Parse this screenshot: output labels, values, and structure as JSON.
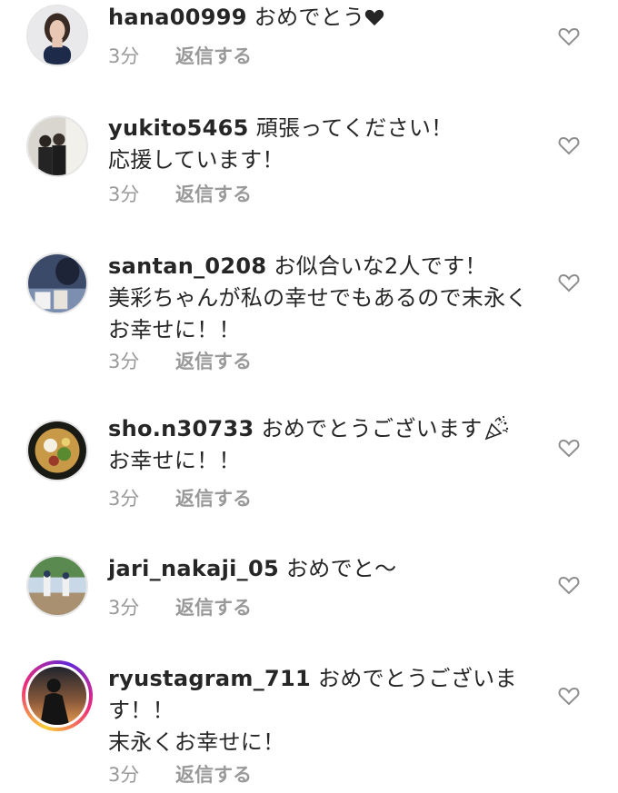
{
  "comments": [
    {
      "user": "hana00999",
      "text": "おめでとう",
      "time": "3分",
      "reply": "返信する",
      "emoji": "black-heart"
    },
    {
      "user": "yukito5465",
      "text": "頑張ってください！\n応援しています！",
      "time": "3分",
      "reply": "返信する"
    },
    {
      "user": "santan_0208",
      "text": "お似合いな2人です！\n美彩ちゃんが私の幸せでもあるので末永くお幸せに！！",
      "time": "3分",
      "reply": "返信する"
    },
    {
      "user": "sho.n30733",
      "text": "おめでとうございます",
      "text2": "\nお幸せに！！",
      "time": "3分",
      "reply": "返信する",
      "emoji": "party-popper"
    },
    {
      "user": "jari_nakaji_05",
      "text": "おめでと〜",
      "time": "3分",
      "reply": "返信する"
    },
    {
      "user": "ryustagram_711",
      "text": "おめでとうございます！！\n末永くお幸せに！",
      "time": "3分",
      "reply": "返信する"
    }
  ],
  "colors": {
    "username": "#262626",
    "meta": "#999999",
    "heart_outline": "#8e8e8e"
  }
}
